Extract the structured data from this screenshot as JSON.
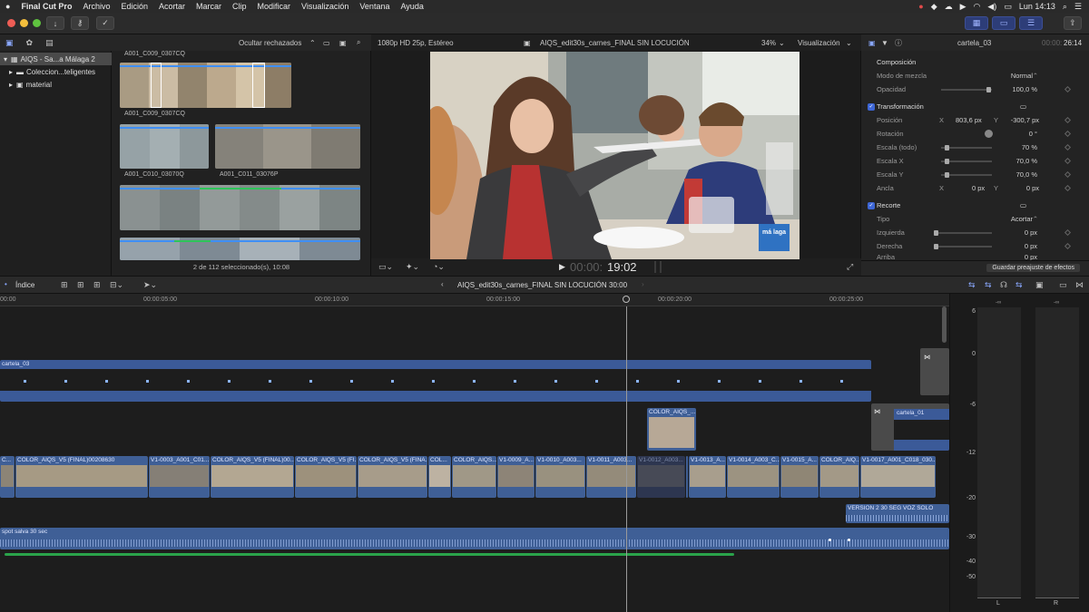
{
  "menubar": {
    "apple": "",
    "app": "Final Cut Pro",
    "items": [
      "Archivo",
      "Edición",
      "Acortar",
      "Marcar",
      "Clip",
      "Modificar",
      "Visualización",
      "Ventana",
      "Ayuda"
    ],
    "clock": "Lun 14:13"
  },
  "toolbar": {
    "import": "↓",
    "key": "⚷",
    "check": "✓"
  },
  "library": {
    "items": [
      "AIQS - Sa...a Málaga 2",
      "Coleccion...teligentes",
      "material"
    ]
  },
  "browser": {
    "filter": "Ocultar rechazados",
    "top_clip_name": "A001_C009_0307CQ",
    "clips": [
      "A001_C009_0307CQ",
      "A001_C010_03070Q",
      "A001_C011_03076P"
    ],
    "status": "2 de 112 seleccionado(s), 10:08"
  },
  "viewer": {
    "format": "1080p HD 25p, Estéreo",
    "project": "AIQS_edit30s_carnes_FINAL SIN LOCUCIÓN",
    "zoom": "34%",
    "view_menu": "Visualización",
    "timecode_dim": "00:00:",
    "timecode": "19:02",
    "logo_text": "má laga"
  },
  "inspector": {
    "title": "cartela_03",
    "duration_dim": "00:00:",
    "duration": "26:14",
    "composicion": "Composición",
    "modo_label": "Modo de mezcla",
    "modo_val": "Normal",
    "opacidad_label": "Opacidad",
    "opacidad_val": "100,0 %",
    "transformacion": "Transformación",
    "posicion_label": "Posición",
    "pos_x_label": "X",
    "pos_x": "803,6 px",
    "pos_y_label": "Y",
    "pos_y": "-300,7 px",
    "rotacion_label": "Rotación",
    "rotacion_val": "0 °",
    "escala_todo_label": "Escala (todo)",
    "escala_todo_val": "70 %",
    "escala_x_label": "Escala X",
    "escala_x_val": "70,0 %",
    "escala_y_label": "Escala Y",
    "escala_y_val": "70,0 %",
    "ancla_label": "Ancla",
    "ancla_x_label": "X",
    "ancla_x": "0 px",
    "ancla_y_label": "Y",
    "ancla_y": "0 px",
    "recorte": "Recorte",
    "tipo_label": "Tipo",
    "tipo_val": "Acortar",
    "izquierda_label": "Izquierda",
    "izquierda_val": "0 px",
    "derecha_label": "Derecha",
    "derecha_val": "0 px",
    "arriba_label": "Arriba",
    "arriba_val": "0 px",
    "save_preset": "Guardar preajuste de efectos"
  },
  "timeline": {
    "index": "Índice",
    "project": "AIQS_edit30s_carnes_FINAL SIN LOCUCIÓN",
    "duration": "30:00",
    "ruler": [
      "00:00",
      "00:00:05:00",
      "00:00:10:00",
      "00:00:15:00",
      "00:00:20:00",
      "00:00:25:00"
    ],
    "title_clip": "cartela_03",
    "color_clip": "COLOR_AIQS_...",
    "cartela_01": "cartela_01",
    "main_clips": [
      "C...",
      "COLOR_AIQS_V5 (FINAL)00208630",
      "V1-0003_A001_C01...",
      "COLOR_AIQS_V5 (FINAL)00...",
      "COLOR_AIQS_V5 (FI...",
      "COLOR_AIQS_V5 (FINA...",
      "COL...",
      "COLOR_AIQS...",
      "V1-0009_A...",
      "V1-0010_A003...",
      "V1-0011_A003...",
      "V1-0012_A003...",
      "COLOR_AIQS_...",
      "V1-0013_A...",
      "V1-0014_A003_C...",
      "V1-0015_A...",
      "COLOR_AIQ...",
      "V1-0017_A001_C018_030..."
    ],
    "version_clip": "VERSION 2 30 SEG VOZ SOLO",
    "audio_clip": "spot salva 30 sec"
  },
  "meters": {
    "peak": "-∞",
    "scale": [
      "6",
      "0",
      "-6",
      "-12",
      "-20",
      "-30",
      "-40",
      "-50"
    ],
    "left": "L",
    "right": "R"
  },
  "colors": {
    "accent": "#3d66d6",
    "clip_blue": "#3f5f96",
    "title_blue": "#3b5a98",
    "audio_green": "#2aa34a"
  }
}
